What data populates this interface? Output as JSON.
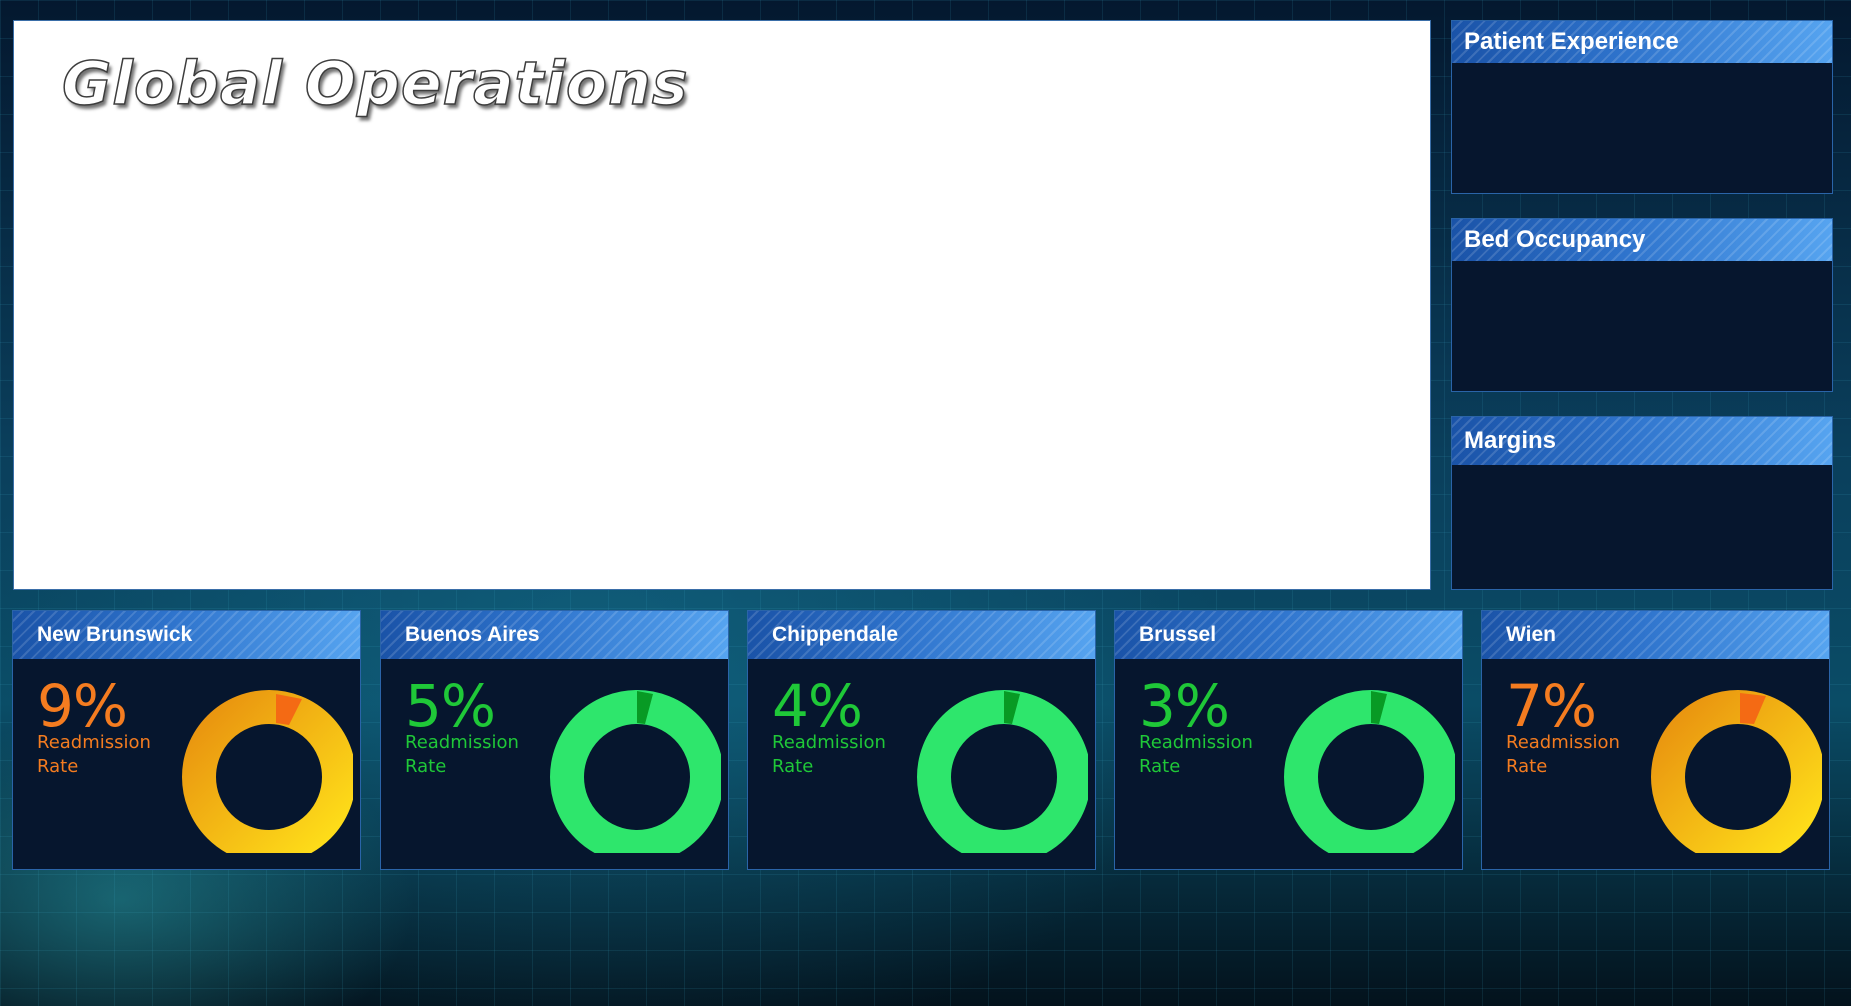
{
  "dashboard": {
    "title": "Global Operations"
  },
  "side_panels": [
    {
      "title": "Patient Experience"
    },
    {
      "title": "Bed Occupancy"
    },
    {
      "title": "Margins"
    }
  ],
  "colors": {
    "header_blue": "#2e73cc",
    "panel_bg": "#06162e",
    "alert_orange": "#f47c20",
    "good_green": "#1fc838"
  },
  "cities": [
    {
      "name": "New Brunswick",
      "value_text": "9%",
      "value": 9,
      "label_line1": "Readmission",
      "label_line2": "Rate",
      "status": "warning"
    },
    {
      "name": "Buenos Aires",
      "value_text": "5%",
      "value": 5,
      "label_line1": "Readmission",
      "label_line2": "Rate",
      "status": "good"
    },
    {
      "name": "Chippendale",
      "value_text": "4%",
      "value": 4,
      "label_line1": "Readmission",
      "label_line2": "Rate",
      "status": "good"
    },
    {
      "name": "Brussel",
      "value_text": "3%",
      "value": 3,
      "label_line1": "Readmission",
      "label_line2": "Rate",
      "status": "good"
    },
    {
      "name": "Wien",
      "value_text": "7%",
      "value": 7,
      "label_line1": "Readmission",
      "label_line2": "Rate",
      "status": "warning"
    }
  ]
}
